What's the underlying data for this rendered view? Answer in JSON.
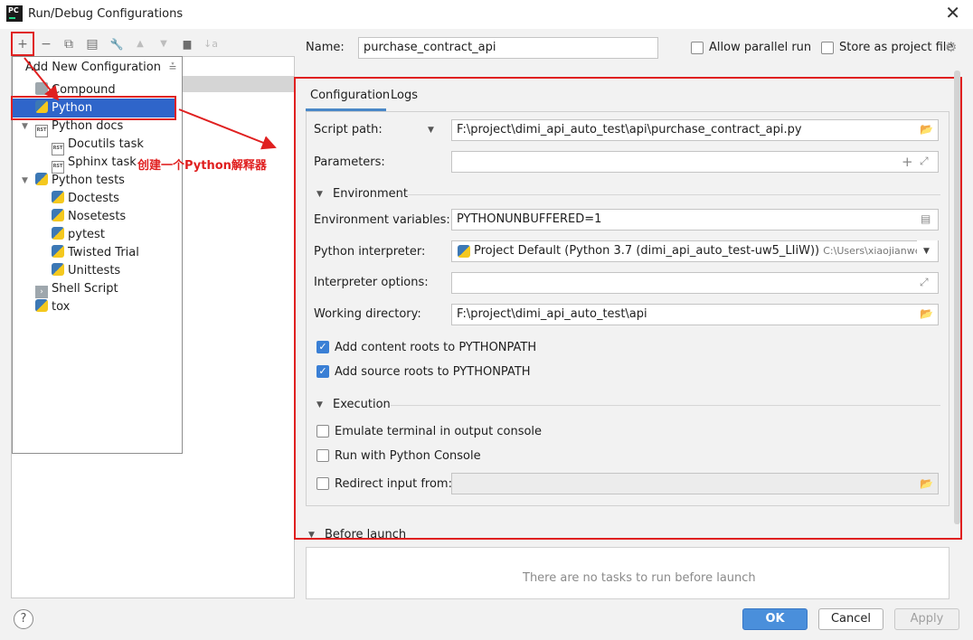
{
  "window": {
    "app_badge": "PC",
    "title": "Run/Debug Configurations",
    "close_glyph": "✕"
  },
  "toolbar": {
    "add": "+",
    "remove": "−",
    "copy": "⧉",
    "save": "▤",
    "edit": "🔧",
    "up": "▲",
    "down": "▼",
    "folder": "▆",
    "sort": "↓a"
  },
  "popup": {
    "header": "Add New Configuration",
    "collapse_glyph": "⩮",
    "items": [
      {
        "label": "Compound",
        "icon": "compound-icon"
      },
      {
        "label": "Python",
        "icon": "python-icon"
      },
      {
        "label": "Python docs",
        "icon": "python-docs-icon"
      },
      {
        "label": "Docutils task",
        "icon": "rst-icon"
      },
      {
        "label": "Sphinx task",
        "icon": "rst-icon"
      },
      {
        "label": "Python tests",
        "icon": "python-tests-icon"
      },
      {
        "label": "Doctests",
        "icon": "python-test-icon"
      },
      {
        "label": "Nosetests",
        "icon": "python-test-icon"
      },
      {
        "label": "pytest",
        "icon": "python-test-icon"
      },
      {
        "label": "Twisted Trial",
        "icon": "python-test-icon"
      },
      {
        "label": "Unittests",
        "icon": "python-test-icon"
      },
      {
        "label": "Shell Script",
        "icon": "shell-icon"
      },
      {
        "label": "tox",
        "icon": "python-icon"
      }
    ],
    "rst_badge": "RST"
  },
  "annotation": {
    "text": "创建一个Python解释器",
    "color": "#e02020"
  },
  "name_row": {
    "name_label": "Name:",
    "name_value": "purchase_contract_api",
    "allow_parallel": "Allow parallel run",
    "store_project": "Store as project file"
  },
  "tabs": {
    "configuration": "Configuration",
    "logs": "Logs"
  },
  "config": {
    "script_path_label": "Script path:",
    "script_path_value": "F:\\project\\dimi_api_auto_test\\api\\purchase_contract_api.py",
    "parameters_label": "Parameters:",
    "environment_section": "Environment",
    "env_vars_label": "Environment variables:",
    "env_vars_value": "PYTHONUNBUFFERED=1",
    "interpreter_label": "Python interpreter:",
    "interpreter_value": "Project Default (Python 3.7 (dimi_api_auto_test-uw5_LIiW))",
    "interpreter_path": "C:\\Users\\xiaojianwen\\.virtuale",
    "interp_options_label": "Interpreter options:",
    "working_dir_label": "Working directory:",
    "working_dir_value": "F:\\project\\dimi_api_auto_test\\api",
    "add_content_roots": "Add content roots to PYTHONPATH",
    "add_source_roots": "Add source roots to PYTHONPATH",
    "execution_section": "Execution",
    "emulate_terminal": "Emulate terminal in output console",
    "run_python_console": "Run with Python Console",
    "redirect_input": "Redirect input from:"
  },
  "before_launch": {
    "title": "Before launch",
    "empty_text": "There are no tasks to run before launch"
  },
  "buttons": {
    "help": "?",
    "ok": "OK",
    "cancel": "Cancel",
    "apply": "Apply"
  },
  "colors": {
    "accent": "#2f65ca",
    "annotation_red": "#e02020",
    "ok_blue": "#4a8fdb"
  }
}
